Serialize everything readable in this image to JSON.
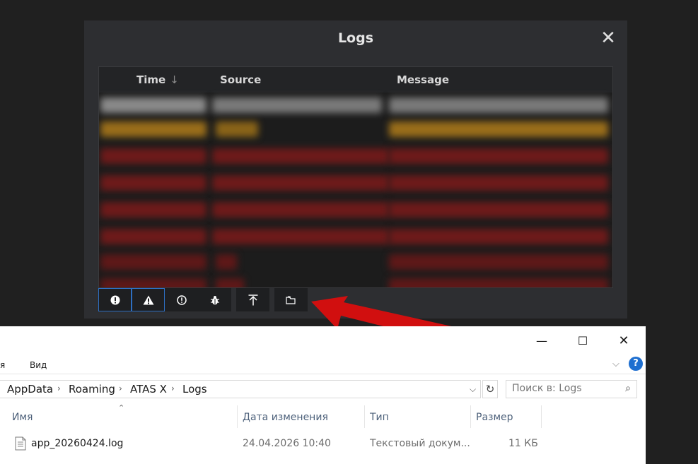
{
  "logs_dialog": {
    "title": "Logs",
    "close_glyph": "✕",
    "columns": {
      "time": "Time",
      "time_sort": "↓",
      "source": "Source",
      "message": "Message"
    },
    "rows": [
      {
        "level": "error",
        "color": "#7a7a7a"
      },
      {
        "level": "warning",
        "color": "#a0741c"
      },
      {
        "level": "error",
        "color": "#7a1e1e"
      },
      {
        "level": "error",
        "color": "#7a1e1e"
      },
      {
        "level": "error",
        "color": "#7a1e1e"
      },
      {
        "level": "error",
        "color": "#7a1e1e"
      },
      {
        "level": "error",
        "color": "#6e1c1c"
      },
      {
        "level": "error",
        "color": "#6e1c1c"
      }
    ],
    "toolbar": [
      {
        "icon": "error-filter-icon",
        "active": true
      },
      {
        "icon": "warning-filter-icon",
        "active": true
      },
      {
        "icon": "info-filter-icon",
        "active": false
      },
      {
        "icon": "debug-filter-icon",
        "active": false
      },
      {
        "icon": "scroll-to-top-icon",
        "active": false
      },
      {
        "icon": "open-folder-icon",
        "active": false
      }
    ]
  },
  "annotation": {
    "arrow_color": "#d10f0f"
  },
  "explorer": {
    "window_controls": {
      "minimize": "—",
      "maximize": "☐",
      "close": "✕"
    },
    "menu": {
      "partial_tab": "я",
      "view": "Вид"
    },
    "help": "?",
    "breadcrumbs": [
      "AppData",
      "Roaming",
      "ATAS X",
      "Logs"
    ],
    "breadcrumb_sep": "›",
    "search_placeholder": "Поиск в: Logs",
    "columns": {
      "name": "Имя",
      "date": "Дата изменения",
      "type": "Тип",
      "size": "Размер"
    },
    "file": {
      "name": "app_20260424.log",
      "date": "24.04.2026 10:40",
      "type": "Текстовый докум...",
      "size": "11 КБ"
    }
  }
}
